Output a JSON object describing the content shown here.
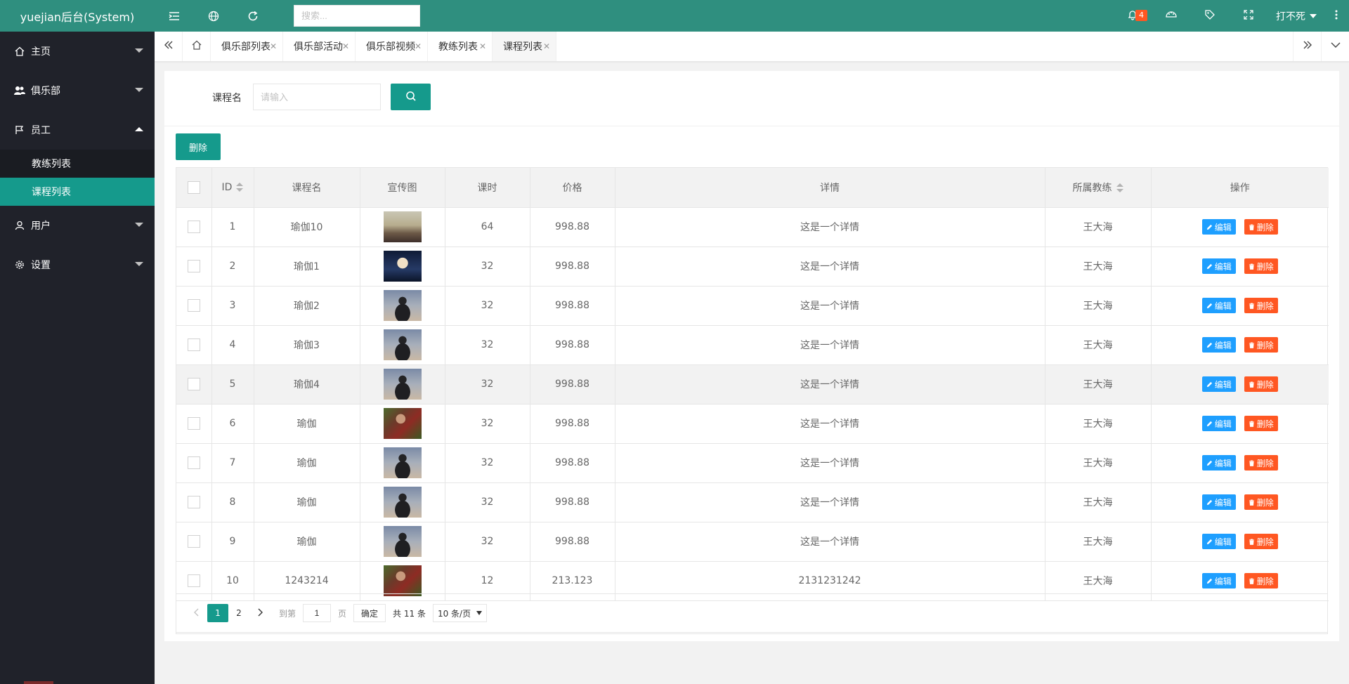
{
  "app": {
    "title": "yuejian后台(System)"
  },
  "colors": {
    "primary": "#2f8f7f",
    "accent": "#159a8c",
    "sidebar": "#20222a",
    "edit": "#1e9fff",
    "delete": "#ff5722"
  },
  "sidebar": {
    "items": [
      {
        "label": "主页",
        "icon": "home-icon"
      },
      {
        "label": "俱乐部",
        "icon": "users-icon"
      },
      {
        "label": "员工",
        "icon": "flag-icon",
        "expanded": true,
        "children": [
          {
            "label": "教练列表"
          },
          {
            "label": "课程列表",
            "active": true
          }
        ]
      },
      {
        "label": "用户",
        "icon": "user-icon"
      },
      {
        "label": "设置",
        "icon": "gear-icon"
      }
    ]
  },
  "topbar": {
    "search_placeholder": "搜索...",
    "notification_count": "4",
    "user_name": "打不死"
  },
  "tabs": [
    {
      "label": "俱乐部列表"
    },
    {
      "label": "俱乐部活动"
    },
    {
      "label": "俱乐部视频"
    },
    {
      "label": "教练列表"
    },
    {
      "label": "课程列表",
      "active": true
    }
  ],
  "search": {
    "label": "课程名",
    "placeholder": "请输入"
  },
  "toolbar": {
    "delete_label": "删除"
  },
  "table": {
    "columns": [
      "ID",
      "课程名",
      "宣传图",
      "课时",
      "价格",
      "详情",
      "所属教练",
      "操作"
    ],
    "edit_label": "编辑",
    "delete_label": "删除",
    "rows": [
      {
        "id": "1",
        "name": "瑜伽10",
        "img": "sunset-girl",
        "hours": "64",
        "price": "998.88",
        "detail": "这是一个详情",
        "coach": "王大海"
      },
      {
        "id": "2",
        "name": "瑜伽1",
        "img": "suit-man",
        "hours": "32",
        "price": "998.88",
        "detail": "这是一个详情",
        "coach": "王大海"
      },
      {
        "id": "3",
        "name": "瑜伽2",
        "img": "silhouette",
        "hours": "32",
        "price": "998.88",
        "detail": "这是一个详情",
        "coach": "王大海"
      },
      {
        "id": "4",
        "name": "瑜伽3",
        "img": "silhouette",
        "hours": "32",
        "price": "998.88",
        "detail": "这是一个详情",
        "coach": "王大海"
      },
      {
        "id": "5",
        "name": "瑜伽4",
        "img": "silhouette",
        "hours": "32",
        "price": "998.88",
        "detail": "这是一个详情",
        "coach": "王大海"
      },
      {
        "id": "6",
        "name": "瑜伽",
        "img": "plaid-man",
        "hours": "32",
        "price": "998.88",
        "detail": "这是一个详情",
        "coach": "王大海"
      },
      {
        "id": "7",
        "name": "瑜伽",
        "img": "silhouette",
        "hours": "32",
        "price": "998.88",
        "detail": "这是一个详情",
        "coach": "王大海"
      },
      {
        "id": "8",
        "name": "瑜伽",
        "img": "silhouette",
        "hours": "32",
        "price": "998.88",
        "detail": "这是一个详情",
        "coach": "王大海"
      },
      {
        "id": "9",
        "name": "瑜伽",
        "img": "silhouette",
        "hours": "32",
        "price": "998.88",
        "detail": "这是一个详情",
        "coach": "王大海"
      },
      {
        "id": "10",
        "name": "1243214",
        "img": "plaid-man",
        "hours": "12",
        "price": "213.123",
        "detail": "2131231242",
        "coach": "王大海"
      }
    ]
  },
  "pagination": {
    "pages": [
      "1",
      "2"
    ],
    "current": "1",
    "goto_prefix": "到第",
    "goto_value": "1",
    "goto_suffix": "页",
    "confirm_label": "确定",
    "total_label": "共 11 条",
    "limit_label": "10 条/页"
  }
}
